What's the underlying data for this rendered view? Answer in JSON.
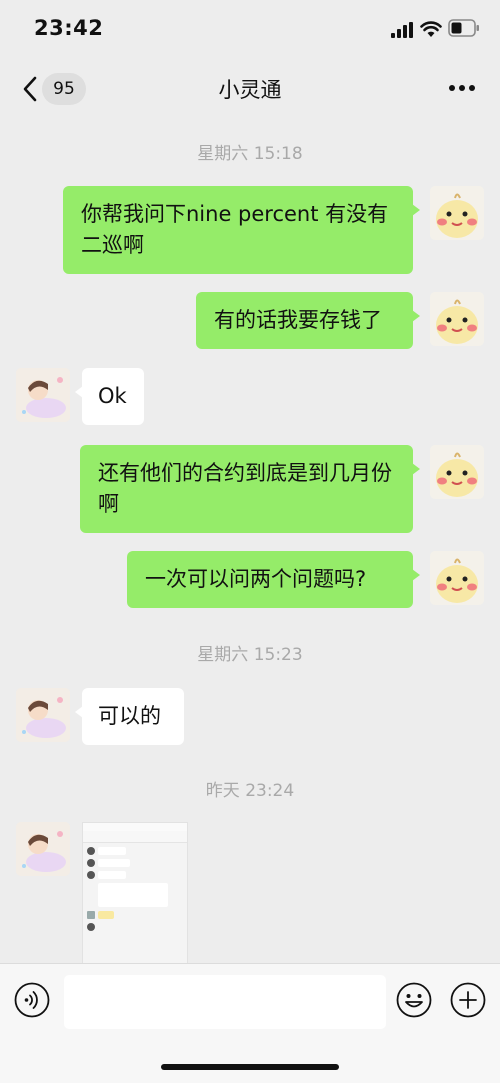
{
  "status_bar": {
    "time": "23:42"
  },
  "nav": {
    "unread_count": "95",
    "title": "小灵通"
  },
  "messages": [
    {
      "type": "timestamp",
      "text": "星期六 15:18"
    },
    {
      "type": "text",
      "sender": "me",
      "text": "你帮我问下nine percent 有没有二巡啊"
    },
    {
      "type": "text",
      "sender": "me",
      "text": "有的话我要存钱了"
    },
    {
      "type": "text",
      "sender": "other",
      "text": "Ok"
    },
    {
      "type": "text",
      "sender": "me",
      "text": "还有他们的合约到底是到几月份啊"
    },
    {
      "type": "text",
      "sender": "me",
      "text": "一次可以问两个问题吗?"
    },
    {
      "type": "timestamp",
      "text": "星期六 15:23"
    },
    {
      "type": "text",
      "sender": "other",
      "text": "可以的"
    },
    {
      "type": "timestamp",
      "text": "昨天 23:24"
    },
    {
      "type": "image",
      "sender": "other"
    }
  ],
  "input": {
    "placeholder": ""
  },
  "colors": {
    "my_bubble": "#95ec69",
    "their_bubble": "#ffffff",
    "background": "#ededed"
  }
}
